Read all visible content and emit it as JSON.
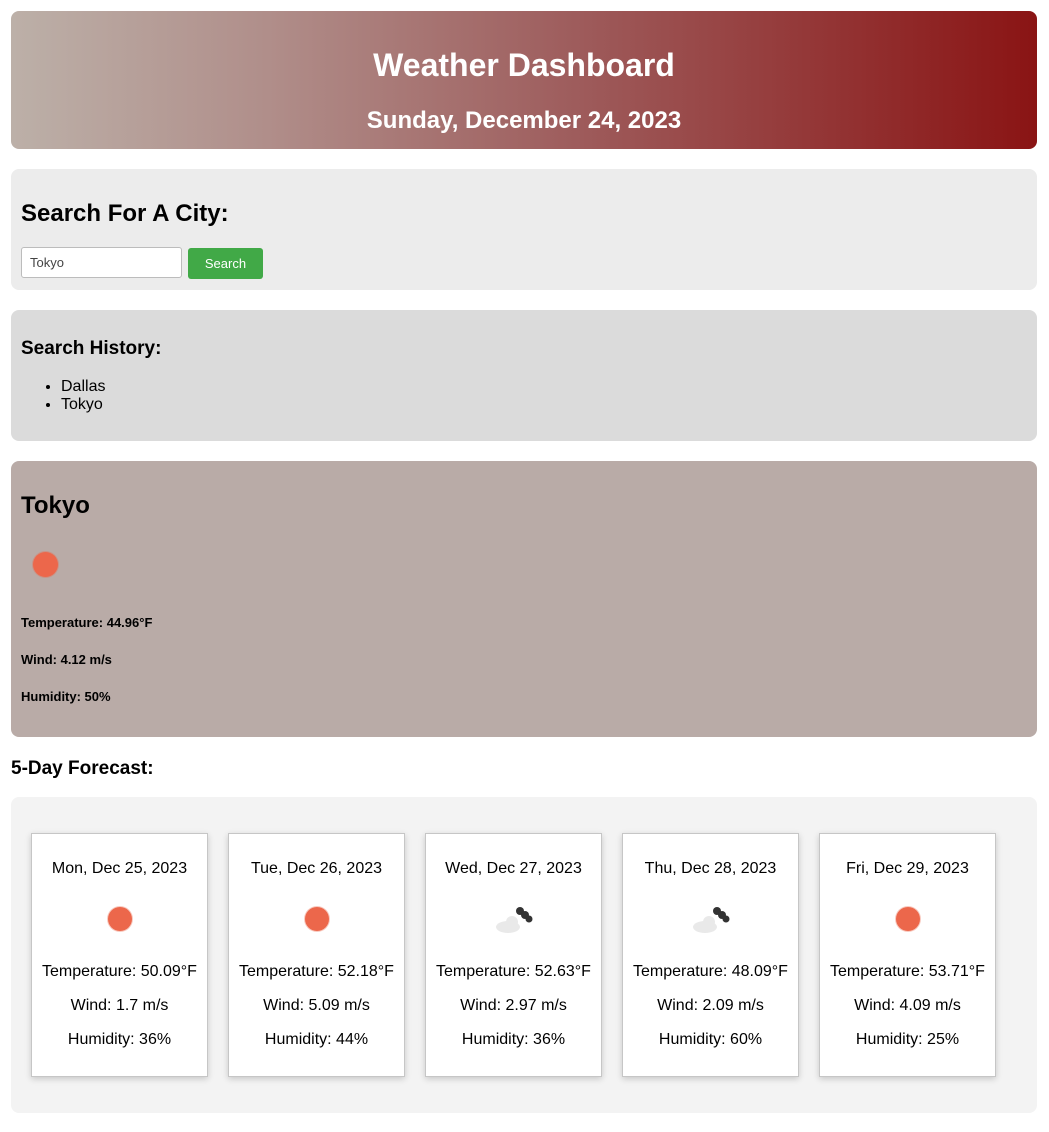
{
  "header": {
    "title": "Weather Dashboard",
    "date": "Sunday, December 24, 2023"
  },
  "search": {
    "heading": "Search For A City:",
    "input_value": "Tokyo",
    "button_label": "Search"
  },
  "history": {
    "heading": "Search History:",
    "items": [
      "Dallas",
      "Tokyo"
    ]
  },
  "current": {
    "city": "Tokyo",
    "icon": "sun-icon",
    "temperature": "Temperature: 44.96°F",
    "wind": "Wind: 4.12 m/s",
    "humidity": "Humidity: 50%"
  },
  "forecast": {
    "heading": "5-Day Forecast:",
    "days": [
      {
        "date": "Mon, Dec 25, 2023",
        "icon": "sun-icon",
        "temperature": "Temperature: 50.09°F",
        "wind": "Wind: 1.7 m/s",
        "humidity": "Humidity: 36%"
      },
      {
        "date": "Tue, Dec 26, 2023",
        "icon": "sun-icon",
        "temperature": "Temperature: 52.18°F",
        "wind": "Wind: 5.09 m/s",
        "humidity": "Humidity: 44%"
      },
      {
        "date": "Wed, Dec 27, 2023",
        "icon": "cloud-icon",
        "temperature": "Temperature: 52.63°F",
        "wind": "Wind: 2.97 m/s",
        "humidity": "Humidity: 36%"
      },
      {
        "date": "Thu, Dec 28, 2023",
        "icon": "cloud-icon",
        "temperature": "Temperature: 48.09°F",
        "wind": "Wind: 2.09 m/s",
        "humidity": "Humidity: 60%"
      },
      {
        "date": "Fri, Dec 29, 2023",
        "icon": "sun-icon",
        "temperature": "Temperature: 53.71°F",
        "wind": "Wind: 4.09 m/s",
        "humidity": "Humidity: 25%"
      }
    ]
  },
  "colors": {
    "sun": "#ec674b",
    "search_button": "#41a947",
    "header_gradient_end": "#8a1414",
    "current_panel": "#b9aba7"
  }
}
